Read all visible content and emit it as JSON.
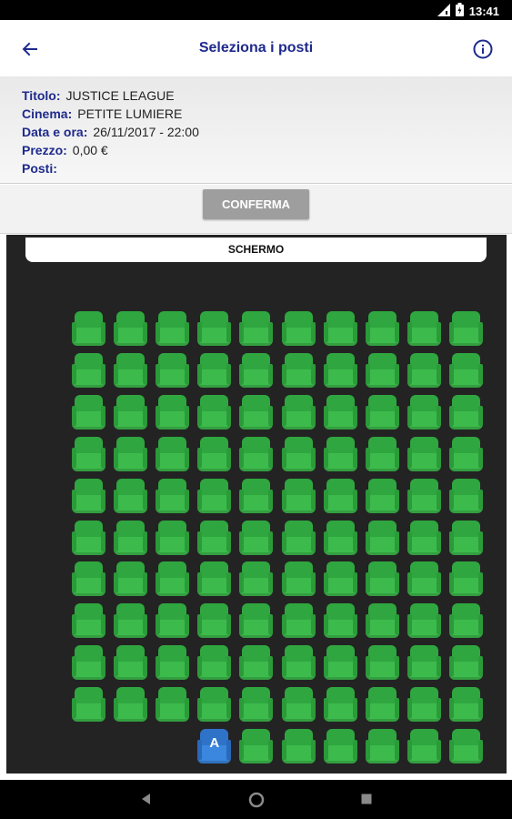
{
  "status_bar": {
    "time": "13:41",
    "icons": [
      "signal-icon",
      "battery-icon"
    ]
  },
  "app_bar": {
    "title": "Seleziona i posti",
    "back_icon": "arrow-back-icon",
    "info_icon": "info-icon"
  },
  "info": {
    "title_label": "Titolo:",
    "title_value": "JUSTICE LEAGUE",
    "cinema_label": "Cinema:",
    "cinema_value": "PETITE LUMIERE",
    "datetime_label": "Data e ora:",
    "datetime_value": "26/11/2017 - 22:00",
    "price_label": "Prezzo:",
    "price_value": "0,00 €",
    "seats_label": "Posti:",
    "seats_value": ""
  },
  "confirm": {
    "label": "CONFERMA"
  },
  "hall": {
    "screen_label": "SCHERMO",
    "rows": 11,
    "cols": 10,
    "seat_color": "#3cbb4c",
    "accessible_color": "#3b86de",
    "last_row": {
      "empty_cols": [
        0,
        1,
        2
      ],
      "accessible_col": 3,
      "accessible_mark": "A"
    }
  },
  "nav_bar": {
    "buttons": [
      "back-triangle-icon",
      "home-circle-icon",
      "recents-square-icon"
    ]
  },
  "colors": {
    "accent": "#1e2a8c",
    "hall_bg": "#232323",
    "confirm_bg": "#9e9e9e"
  }
}
